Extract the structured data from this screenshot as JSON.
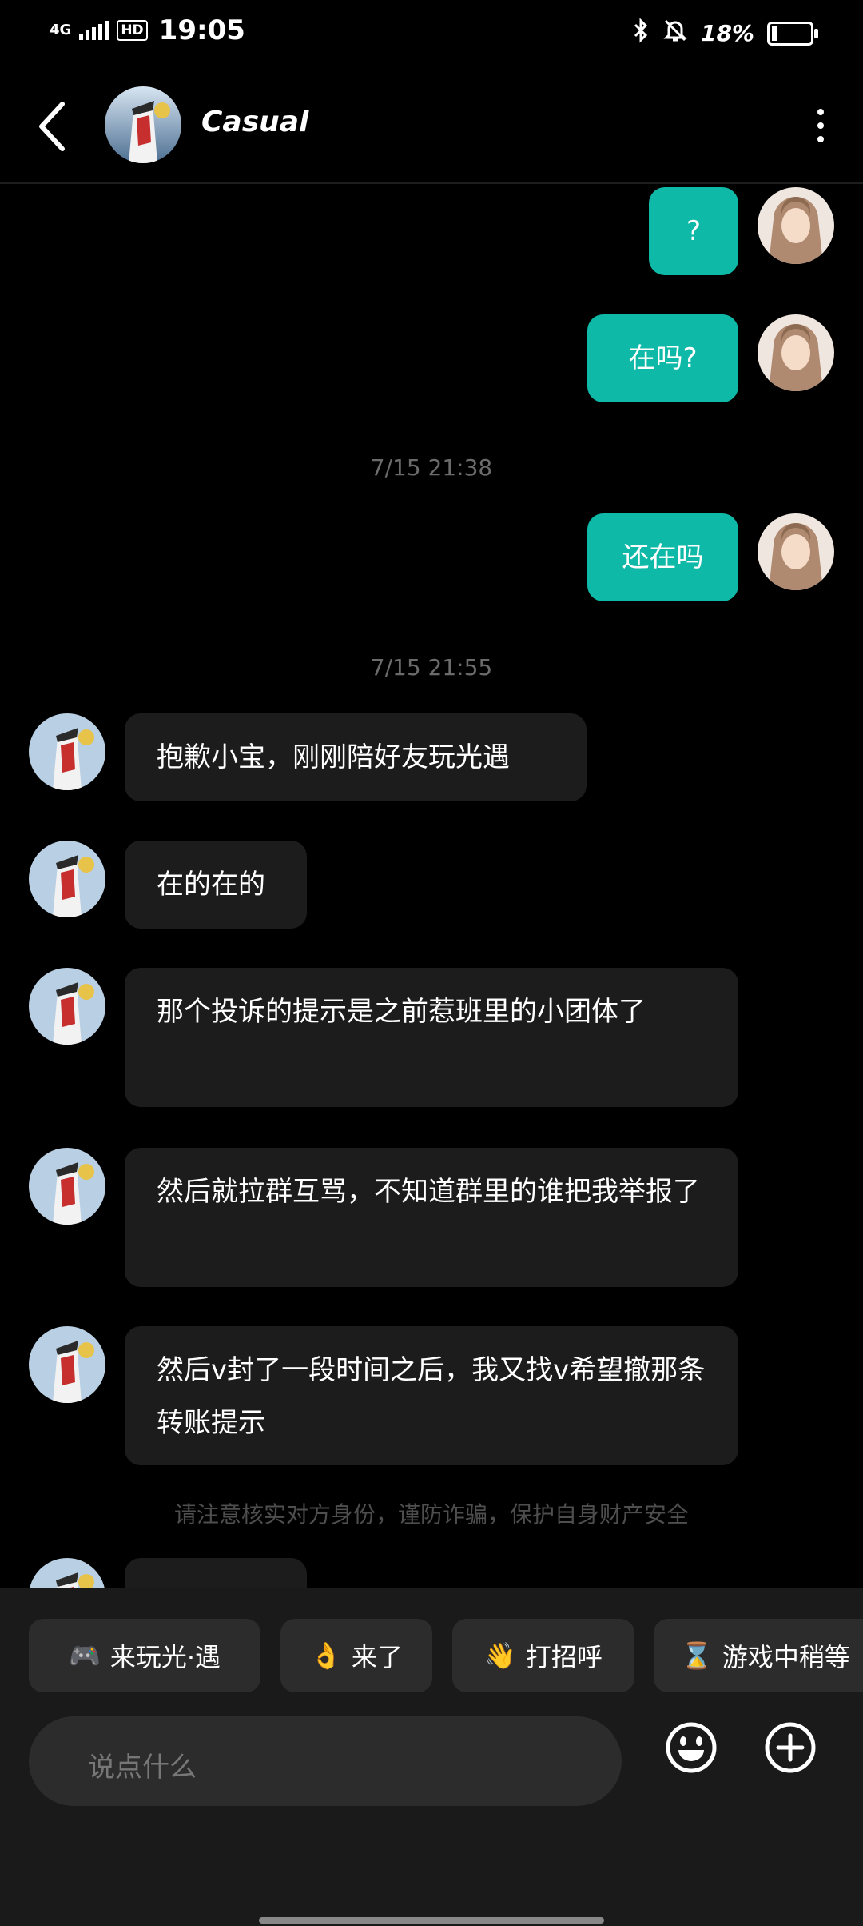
{
  "status_bar": {
    "network": "4G",
    "hd": "HD",
    "time": "19:05",
    "battery": "18%",
    "battery_level": 0.18
  },
  "header": {
    "contact_name": "Casual"
  },
  "messages": {
    "sent_1": "?",
    "sent_2": "在吗?",
    "ts_1": "7/15   21:38",
    "sent_3": "还在吗",
    "ts_2": "7/15   21:55",
    "recv_1": "抱歉小宝，刚刚陪好友玩光遇",
    "recv_2": "在的在的",
    "recv_3": "那个投诉的提示是之前惹班里的小团体了",
    "recv_4": "然后就拉群互骂，不知道群里的谁把我举报了",
    "recv_5": "然后v封了一段时间之后，我又找v希望撤那条转账提示",
    "warning": "请注意核实对方身份，谨防诈骗，保护自身财产安全"
  },
  "quick_replies": [
    {
      "emoji": "🎮",
      "label": "来玩光·遇"
    },
    {
      "emoji": "👌",
      "label": "来了"
    },
    {
      "emoji": "👋",
      "label": "打招呼"
    },
    {
      "emoji": "⌛",
      "label": "游戏中稍等"
    }
  ],
  "composer": {
    "placeholder": "说点什么"
  },
  "colors": {
    "accent": "#0fb9a8",
    "received_bubble": "#1c1c1c",
    "background": "#000000"
  }
}
